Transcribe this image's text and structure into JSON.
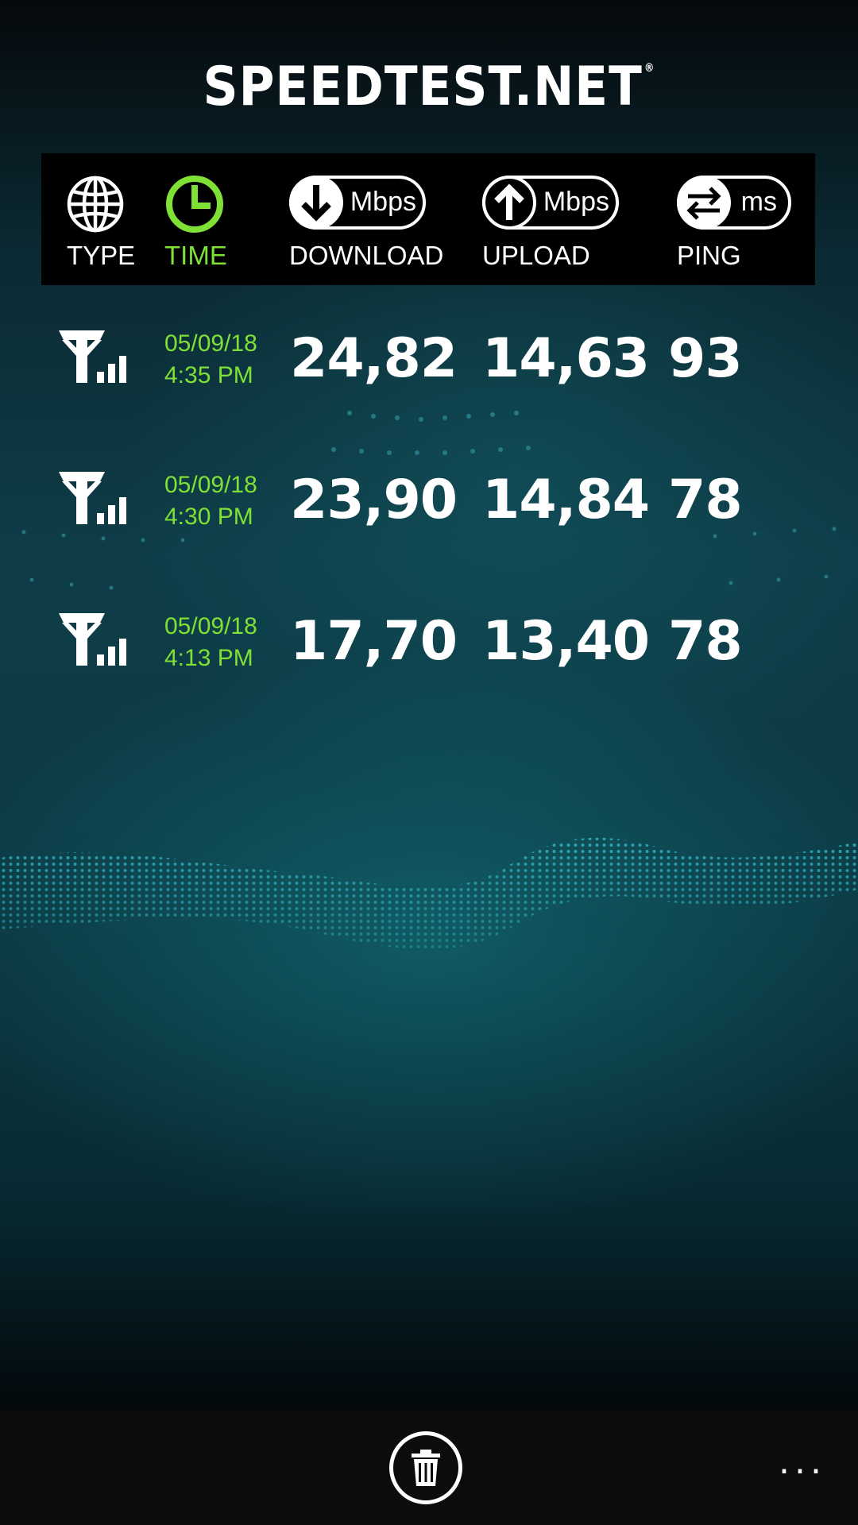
{
  "app": {
    "logo": "SPEEDTEST.NET",
    "logo_mark": "®"
  },
  "colors": {
    "accent": "#7fe035",
    "header_bg": "#000000",
    "appbar_bg": "#0c0c0c"
  },
  "header": {
    "type": {
      "label": "TYPE",
      "icon": "globe-icon"
    },
    "time": {
      "label": "TIME",
      "icon": "clock-icon",
      "active": true
    },
    "download": {
      "label": "DOWNLOAD",
      "unit": "Mbps",
      "icon": "arrow-down-icon"
    },
    "upload": {
      "label": "UPLOAD",
      "unit": "Mbps",
      "icon": "arrow-up-icon"
    },
    "ping": {
      "label": "PING",
      "unit": "ms",
      "icon": "swap-arrows-icon"
    }
  },
  "results": [
    {
      "type_icon": "cellular-signal-icon",
      "date": "05/09/18",
      "time": "4:35 PM",
      "download": "24,82",
      "upload": "14,63",
      "ping": "93"
    },
    {
      "type_icon": "cellular-signal-icon",
      "date": "05/09/18",
      "time": "4:30 PM",
      "download": "23,90",
      "upload": "14,84",
      "ping": "78"
    },
    {
      "type_icon": "cellular-signal-icon",
      "date": "05/09/18",
      "time": "4:13 PM",
      "download": "17,70",
      "upload": "13,40",
      "ping": "78"
    }
  ],
  "appbar": {
    "delete_icon": "trash-icon",
    "more_label": "..."
  }
}
